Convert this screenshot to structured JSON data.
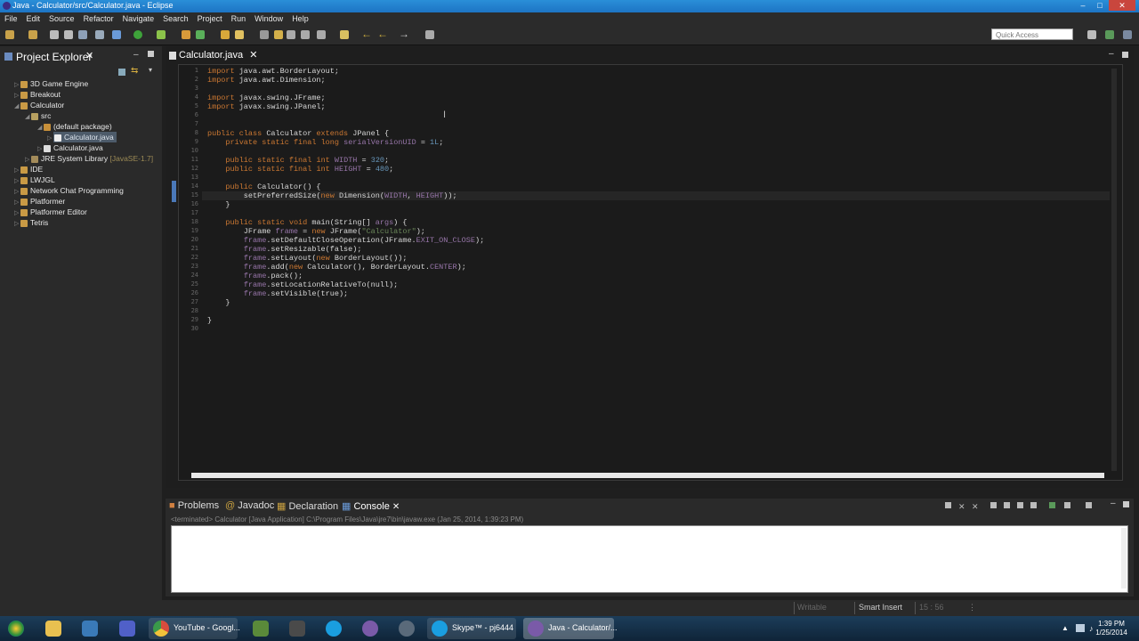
{
  "window": {
    "title": "Java - Calculator/src/Calculator.java - Eclipse"
  },
  "menu": [
    "File",
    "Edit",
    "Source",
    "Refactor",
    "Navigate",
    "Search",
    "Project",
    "Run",
    "Window",
    "Help"
  ],
  "toolbar": {
    "quick_access_placeholder": "Quick Access"
  },
  "project_explorer": {
    "title": "Project Explorer",
    "items": [
      {
        "label": "3D Game Engine"
      },
      {
        "label": "Breakout"
      },
      {
        "label": "Calculator"
      },
      {
        "label": "src"
      },
      {
        "label": "(default package)"
      },
      {
        "label": "Calculator.java"
      },
      {
        "label": "Calculator.java"
      },
      {
        "label": "JRE System Library",
        "suffix": "[JavaSE-1.7]"
      },
      {
        "label": "IDE"
      },
      {
        "label": "LWJGL"
      },
      {
        "label": "Network Chat Programming"
      },
      {
        "label": "Platformer"
      },
      {
        "label": "Platformer Editor"
      },
      {
        "label": "Tetris"
      }
    ]
  },
  "editor": {
    "tab": "Calculator.java",
    "line_numbers": [
      "1",
      "2",
      "3",
      "4",
      "5",
      "6",
      "7",
      "8",
      "9",
      "10",
      "11",
      "12",
      "13",
      "14",
      "15",
      "16",
      "17",
      "18",
      "19",
      "20",
      "21",
      "22",
      "23",
      "24",
      "25",
      "26",
      "27",
      "28",
      "29",
      "30"
    ],
    "lines": [
      "import java.awt.BorderLayout;",
      "import java.awt.Dimension;",
      "",
      "import javax.swing.JFrame;",
      "import javax.swing.JPanel;",
      "",
      "",
      "public class Calculator extends JPanel {",
      "    private static final long serialVersionUID = 1L;",
      "",
      "    public static final int WIDTH = 320;",
      "    public static final int HEIGHT = 480;",
      "",
      "    public Calculator() {",
      "        setPreferredSize(new Dimension(WIDTH, HEIGHT));",
      "    }",
      "",
      "    public static void main(String[] args) {",
      "        JFrame frame = new JFrame(\"Calculator\");",
      "        frame.setDefaultCloseOperation(JFrame.EXIT_ON_CLOSE);",
      "        frame.setResizable(false);",
      "        frame.setLayout(new BorderLayout());",
      "        frame.add(new Calculator(), BorderLayout.CENTER);",
      "        frame.pack();",
      "        frame.setLocationRelativeTo(null);",
      "        frame.setVisible(true);",
      "    }",
      "",
      "}",
      ""
    ]
  },
  "bottom_panel": {
    "tabs": [
      "Problems",
      "Javadoc",
      "Declaration",
      "Console"
    ],
    "console_header": "<terminated> Calculator [Java Application] C:\\Program Files\\Java\\jre7\\bin\\javaw.exe (Jan 25, 2014, 1:39:23 PM)"
  },
  "status_bar": {
    "writable": "Writable",
    "insert_mode": "Smart Insert",
    "position": "15 : 56"
  },
  "taskbar": {
    "tasks": [
      "YouTube - Googl...",
      "Skype™ - pj6444",
      "Java - Calculator/..."
    ],
    "time": "1:39 PM",
    "date": "1/25/2014"
  },
  "colors": {
    "keyword": "#cc7832",
    "type": "#e6b55e",
    "string": "#6a8759",
    "number": "#6897bb",
    "field": "#9876aa"
  }
}
